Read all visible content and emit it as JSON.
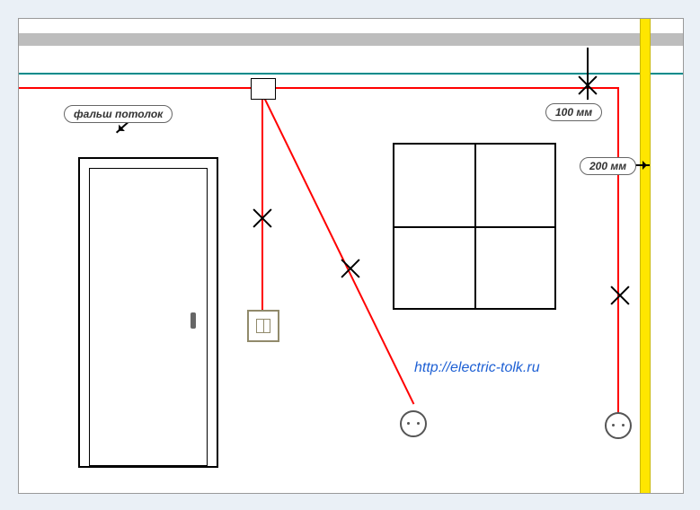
{
  "labels": {
    "false_ceiling": "фальш потолок",
    "dim_100": "100 мм",
    "dim_200": "200 мм"
  },
  "url": "http://electric-tolk.ru",
  "elements": {
    "junction_box": "junction-box",
    "switch": "light-switch",
    "sockets": [
      "socket-1",
      "socket-2"
    ],
    "door": "door",
    "window": "window",
    "false_ceiling_line": "false-ceiling",
    "ceiling_slab": "ceiling-slab",
    "corner_strip": "wall-corner",
    "wiring": [
      "main-horizontal",
      "drop-to-switch",
      "drop-to-right-socket",
      "diagonal-to-left-socket"
    ],
    "cross_marks": 4
  },
  "dimensions": {
    "from_ceiling_to_wire_mm": 100,
    "from_corner_to_wire_mm": 200
  },
  "colors": {
    "wire": "#ff0000",
    "false_ceiling": "#008b8b",
    "corner_strip": "#ffe600",
    "slab": "#bdbdbd"
  }
}
